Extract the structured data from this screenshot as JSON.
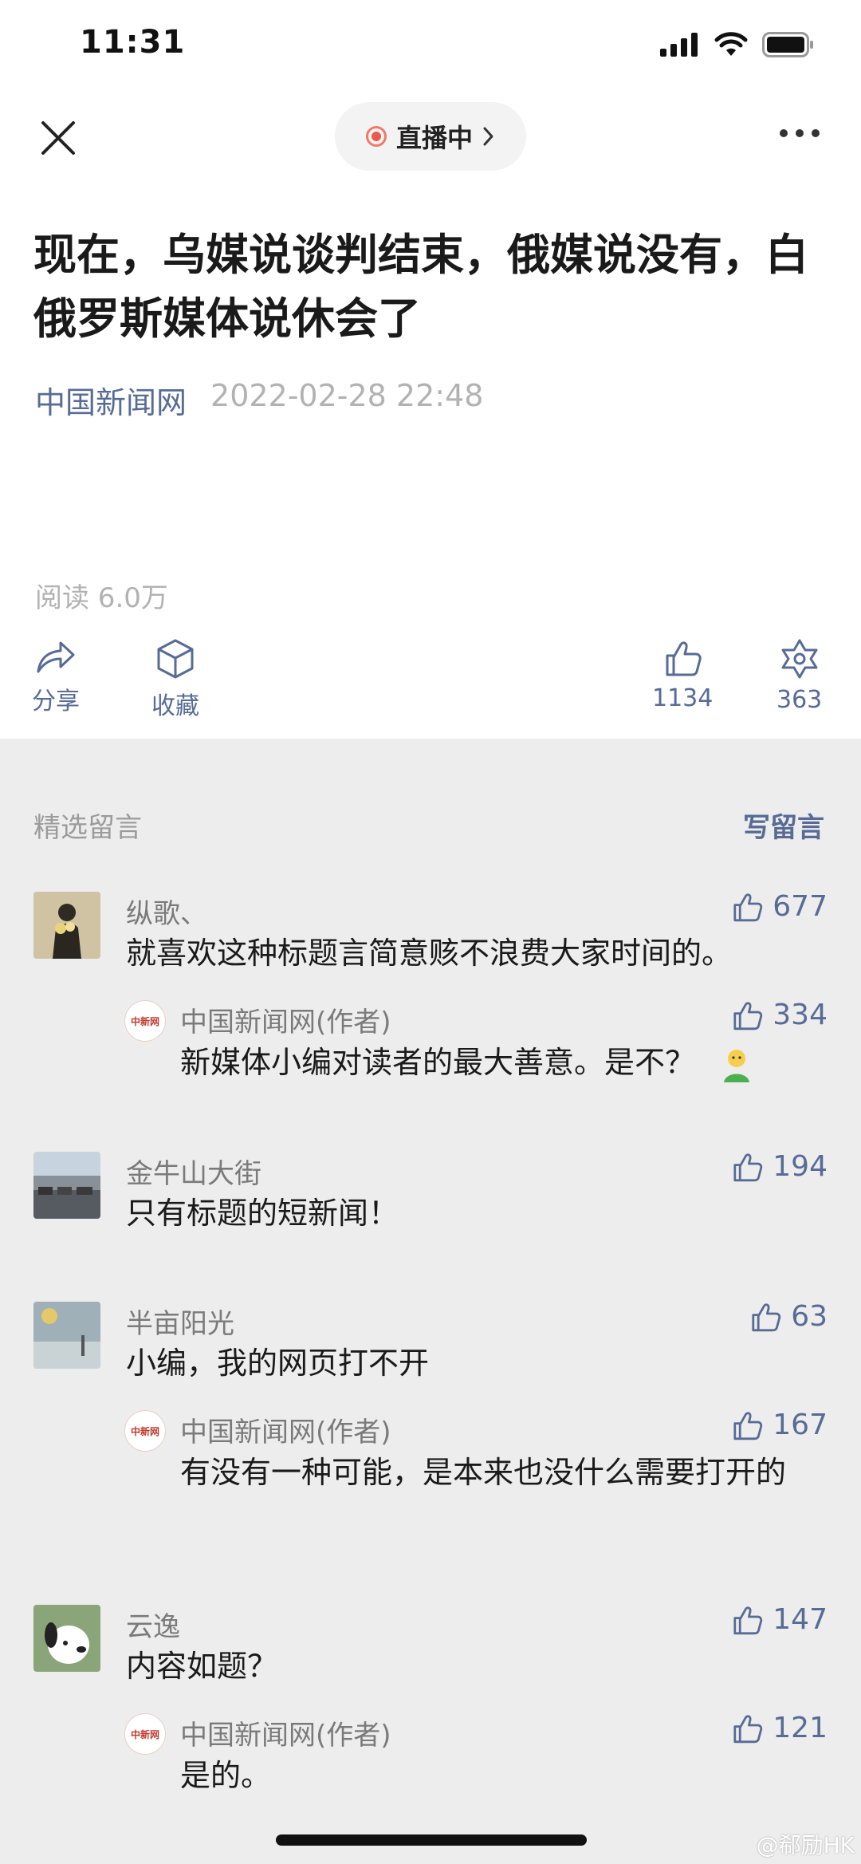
{
  "status_bar": {
    "time": "11:31"
  },
  "nav": {
    "live_label": "直播中"
  },
  "article": {
    "title": "现在，乌媒说谈判结束，俄媒说没有，白俄罗斯媒体说休会了",
    "source": "中国新闻网",
    "date": "2022-02-28 22:48",
    "reads": "阅读 6.0万"
  },
  "actions": {
    "share": "分享",
    "favorite": "收藏",
    "likes": "1134",
    "wow": "363"
  },
  "comments_section": {
    "label": "精选留言",
    "write": "写留言",
    "items": [
      {
        "name": "纵歌、",
        "likes": "677",
        "text": "就喜欢这种标题言简意赅不浪费大家时间的。",
        "reply": {
          "name": "中国新闻网(作者)",
          "likes": "334",
          "text": "新媒体小编对读者的最大善意。是不？"
        }
      },
      {
        "name": "金牛山大街",
        "likes": "194",
        "text": "只有标题的短新闻！"
      },
      {
        "name": "半亩阳光",
        "likes": "63",
        "text": "小编，我的网页打不开",
        "reply": {
          "name": "中国新闻网(作者)",
          "likes": "167",
          "text": "有没有一种可能，是本来也没什么需要打开的"
        }
      },
      {
        "name": "云逸",
        "likes": "147",
        "text": "内容如题？",
        "reply": {
          "name": "中国新闻网(作者)",
          "likes": "121",
          "text": "是的。"
        }
      }
    ]
  },
  "reply_avatar_logo": "中新网",
  "watermark": "@郗励HK",
  "colors": {
    "link": "#576b95",
    "live": "#ea5a48",
    "background": "#ededed"
  }
}
